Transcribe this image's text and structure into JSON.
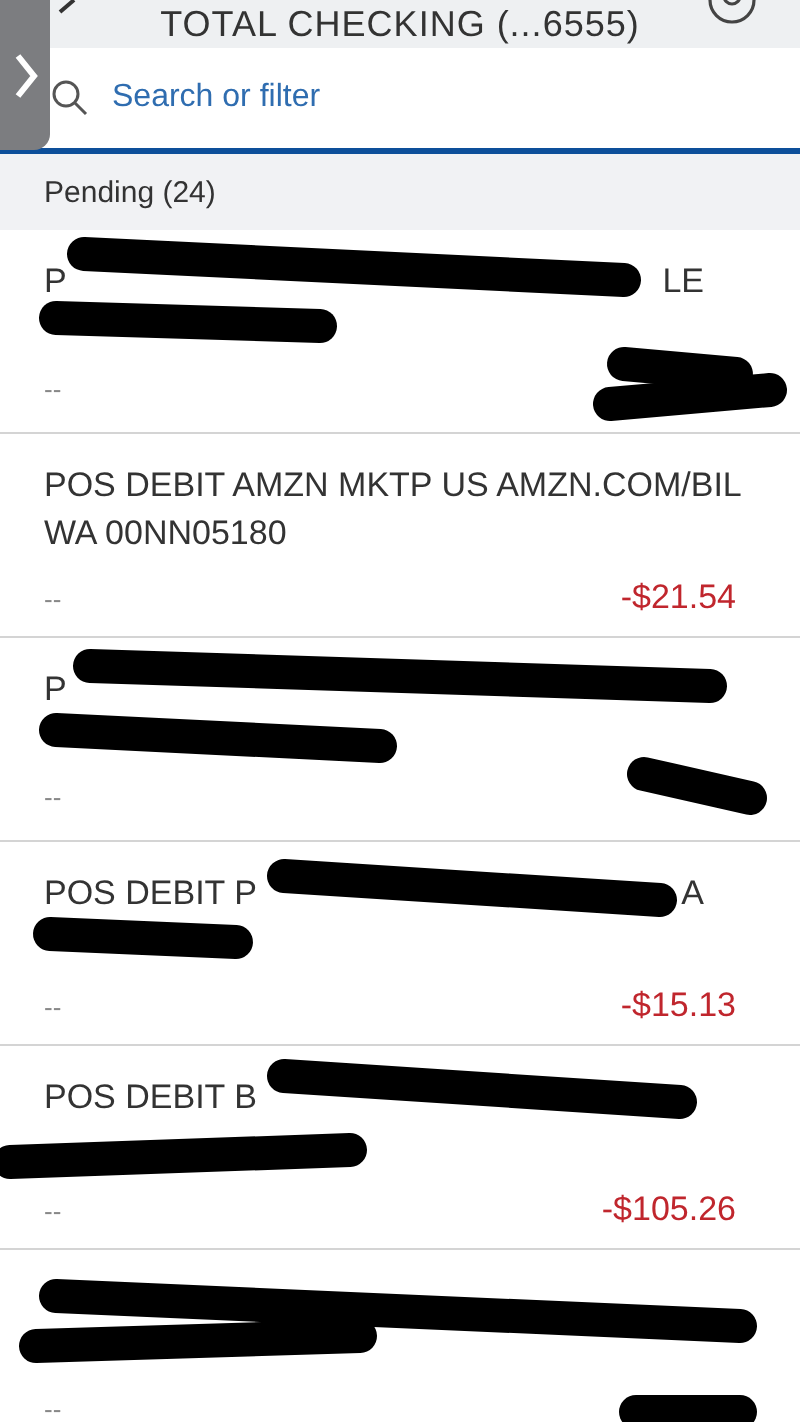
{
  "header": {
    "title": "TOTAL CHECKING  (...6555)"
  },
  "search": {
    "placeholder": "Search or filter"
  },
  "section": {
    "title": "Pending (24)"
  },
  "transactions": [
    {
      "lines": [
        {
          "text": "P",
          "tail": "LE"
        }
      ],
      "date": "--",
      "redacted": true
    },
    {
      "lines": [
        {
          "text": "POS DEBIT AMZN MKTP US AMZN.COM/BIL"
        },
        {
          "text": "WA 00NN05180"
        }
      ],
      "date": "--",
      "amount": "-$21.54",
      "redacted": false
    },
    {
      "lines": [
        {
          "text": "P"
        }
      ],
      "date": "--",
      "redacted": true
    },
    {
      "lines": [
        {
          "text": "POS DEBIT P",
          "tail": "A"
        }
      ],
      "date": "--",
      "amount": "-$15.13",
      "redacted": true
    },
    {
      "lines": [
        {
          "text": "POS DEBIT B"
        }
      ],
      "date": "--",
      "amount": "-$105.26",
      "redacted": true
    },
    {
      "date": "--",
      "redacted": true
    }
  ]
}
